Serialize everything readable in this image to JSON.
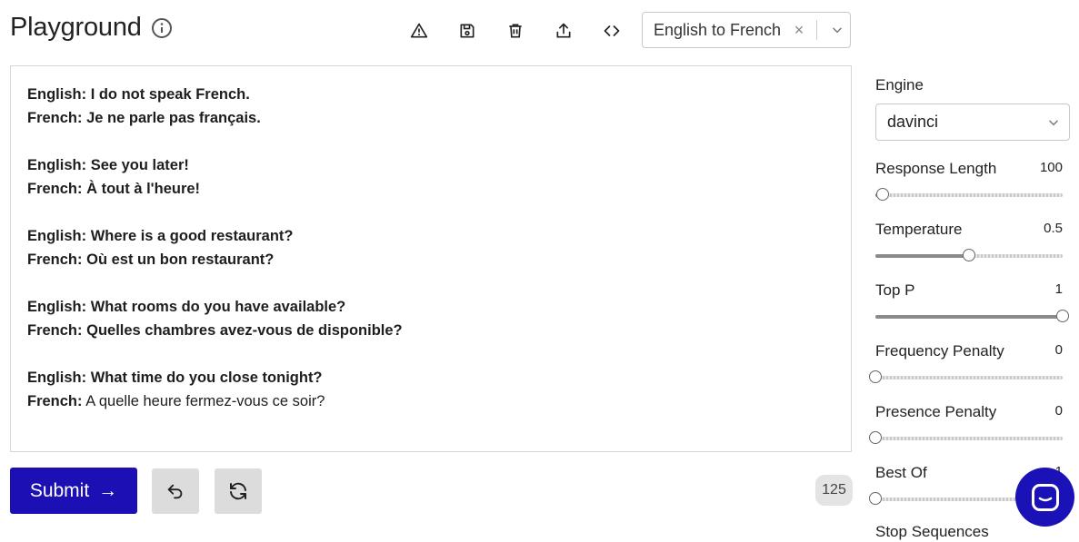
{
  "header": {
    "title": "Playground",
    "icons": [
      "info-icon",
      "warning-icon",
      "save-icon",
      "trash-icon",
      "share-icon",
      "code-icon"
    ],
    "preset": {
      "value": "English to French",
      "clear": "×"
    }
  },
  "editor": {
    "pairs": [
      {
        "en_label": "English:",
        "en_text": "I do not speak French.",
        "fr_label": "French:",
        "fr_text": "Je ne parle pas français."
      },
      {
        "en_label": "English:",
        "en_text": "See you later!",
        "fr_label": "French:",
        "fr_text": "À tout à l'heure!"
      },
      {
        "en_label": "English:",
        "en_text": "Where is a good restaurant?",
        "fr_label": "French:",
        "fr_text": "Où est un bon restaurant?"
      },
      {
        "en_label": "English:",
        "en_text": "What rooms do you have available?",
        "fr_label": "French:",
        "fr_text": "Quelles chambres avez-vous de disponible?"
      },
      {
        "en_label": "English:",
        "en_text": "What time do you close tonight?",
        "fr_label": "French:",
        "fr_text": "A quelle heure fermez-vous ce soir?"
      }
    ]
  },
  "actions": {
    "submit_label": "Submit",
    "submit_arrow": "→",
    "token_count": "125"
  },
  "settings": {
    "engine_label": "Engine",
    "engine_value": "davinci",
    "params": [
      {
        "label": "Response Length",
        "value": "100",
        "fraction": 0.04
      },
      {
        "label": "Temperature",
        "value": "0.5",
        "fraction": 0.5
      },
      {
        "label": "Top P",
        "value": "1",
        "fraction": 1.0
      },
      {
        "label": "Frequency Penalty",
        "value": "0",
        "fraction": 0.0
      },
      {
        "label": "Presence Penalty",
        "value": "0",
        "fraction": 0.0
      },
      {
        "label": "Best Of",
        "value": "1",
        "fraction": 0.0
      }
    ],
    "stop_sequences_label": "Stop Sequences"
  },
  "colors": {
    "accent": "#1c10b5",
    "chat_bubble": "#1a12b6"
  }
}
